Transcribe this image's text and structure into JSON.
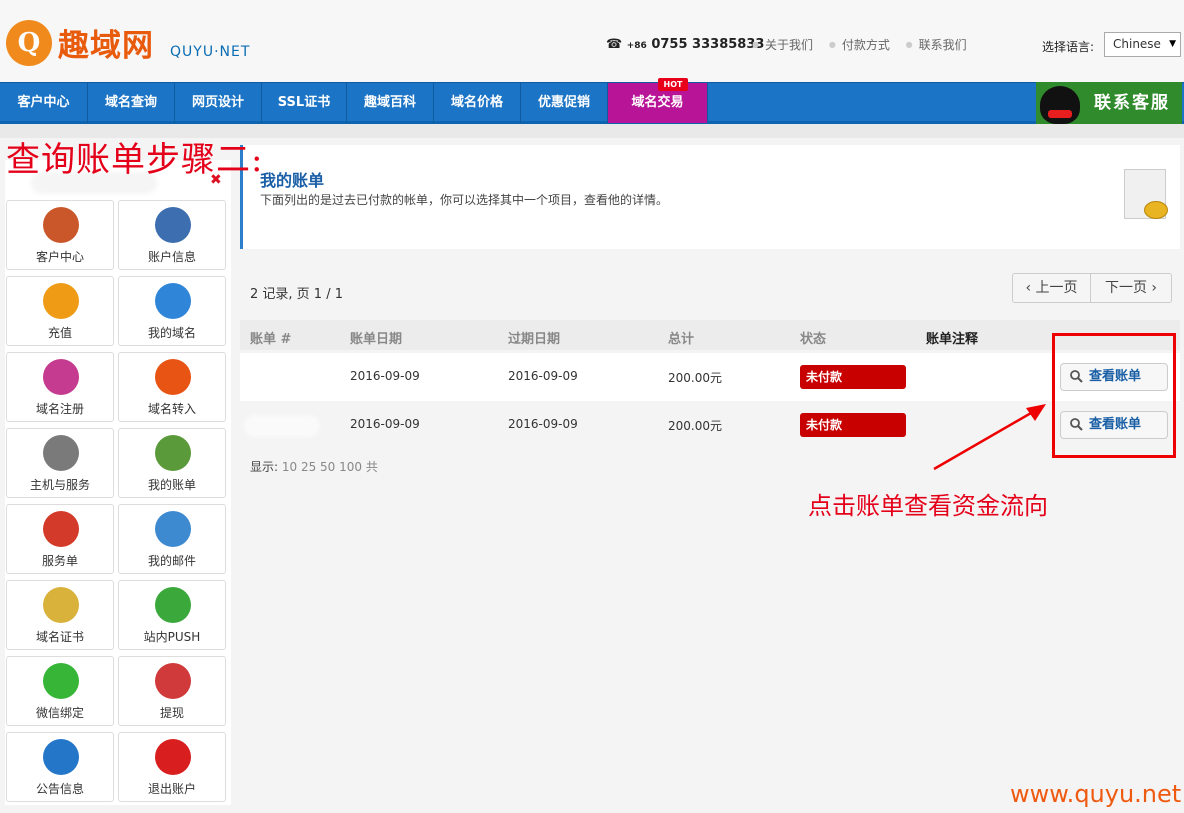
{
  "header": {
    "logo_badge": "Q",
    "logo_cn": "趣域网",
    "logo_en": "QUYU·NET",
    "phone_prefix": "+86",
    "phone_number": "0755 33385833",
    "links": [
      "关于我们",
      "付款方式",
      "联系我们"
    ],
    "language_label": "选择语言:",
    "language_value": "Chinese"
  },
  "nav": {
    "items": [
      "客户中心",
      "域名查询",
      "网页设计",
      "SSL证书",
      "趣域百科",
      "域名价格",
      "优惠促销",
      "域名交易"
    ],
    "hot_badge": "HOT",
    "service_label": "联系客服"
  },
  "annotations": {
    "step_note": "查询账单步骤二:",
    "click_note": "点击账单查看资金流向",
    "watermark": "www.quyu.net"
  },
  "sidebar": {
    "items": [
      {
        "label": "客户中心",
        "icon": "house-icon",
        "color": "#c9572a"
      },
      {
        "label": "账户信息",
        "icon": "user-icon",
        "color": "#3d6fb0"
      },
      {
        "label": "充值",
        "icon": "coins-icon",
        "color": "#f09b16"
      },
      {
        "label": "我的域名",
        "icon": "globe-icon",
        "color": "#2f86d8"
      },
      {
        "label": "域名注册",
        "icon": "cart-icon",
        "color": "#c53b8f"
      },
      {
        "label": "域名转入",
        "icon": "transfer-icon",
        "color": "#e85414"
      },
      {
        "label": "主机与服务",
        "icon": "server-icon",
        "color": "#7a7a7a"
      },
      {
        "label": "我的账单",
        "icon": "bill-icon",
        "color": "#5a9a3a"
      },
      {
        "label": "服务单",
        "icon": "lifebuoy-icon",
        "color": "#d33a2a"
      },
      {
        "label": "我的邮件",
        "icon": "mail-icon",
        "color": "#3e8ad0"
      },
      {
        "label": "域名证书",
        "icon": "icann-icon",
        "color": "#d8b23a"
      },
      {
        "label": "站内PUSH",
        "icon": "push-icon",
        "color": "#3aa83a"
      },
      {
        "label": "微信绑定",
        "icon": "wechat-icon",
        "color": "#36b536"
      },
      {
        "label": "提现",
        "icon": "cash-icon",
        "color": "#d03a3a"
      },
      {
        "label": "公告信息",
        "icon": "help-icon",
        "color": "#2476c9"
      },
      {
        "label": "退出账户",
        "icon": "power-icon",
        "color": "#d81e1e"
      }
    ]
  },
  "main": {
    "title": "我的账单",
    "description": "下面列出的是过去已付款的帐单，你可以选择其中一个项目，查看他的详情。",
    "records": "2 记录, 页 1 / 1",
    "prev_label": "上一页",
    "next_label": "下一页",
    "columns": [
      "账单 #",
      "账单日期",
      "过期日期",
      "总计",
      "状态",
      "账单注释"
    ],
    "rows": [
      {
        "date": "2016-09-09",
        "due": "2016-09-09",
        "total": "200.00元",
        "status": "未付款",
        "action": "查看账单"
      },
      {
        "date": "2016-09-09",
        "due": "2016-09-09",
        "total": "200.00元",
        "status": "未付款",
        "action": "查看账单"
      }
    ],
    "show_label": "显示:",
    "show_options": "10 25 50 100 共"
  }
}
